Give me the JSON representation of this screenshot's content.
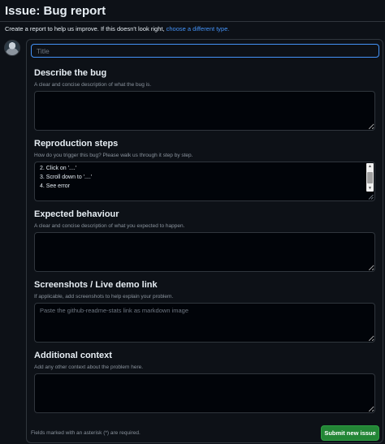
{
  "header": {
    "title": "Issue: Bug report",
    "subtitle_text": "Create a report to help us improve. If this doesn't look right,",
    "subtitle_link": "choose a different type."
  },
  "form": {
    "title_placeholder": "Title",
    "sections": [
      {
        "label": "Describe the bug",
        "description": "A clear and concise description of what the bug is.",
        "placeholder": ""
      },
      {
        "label": "Reproduction steps",
        "description": "How do you trigger this bug? Please walk us through it step by step.",
        "lines": [
          "2. Click on '....'",
          "3. Scroll down to '....'",
          "4. See error"
        ]
      },
      {
        "label": "Expected behaviour",
        "description": "A clear and concise description of what you expected to happen.",
        "placeholder": ""
      },
      {
        "label": "Screenshots / Live demo link",
        "description": "If applicable, add screenshots to help explain your problem.",
        "placeholder": "Paste the github-readme-stats link as markdown image"
      },
      {
        "label": "Additional context",
        "description": "Add any other context about the problem here.",
        "placeholder": ""
      }
    ],
    "footer_note": "Fields marked with an asterisk (*) are required.",
    "submit_label": "Submit new issue"
  },
  "colors": {
    "background": "#0d1117",
    "border": "#30363d",
    "accent": "#4493f8",
    "submit": "#238636"
  }
}
